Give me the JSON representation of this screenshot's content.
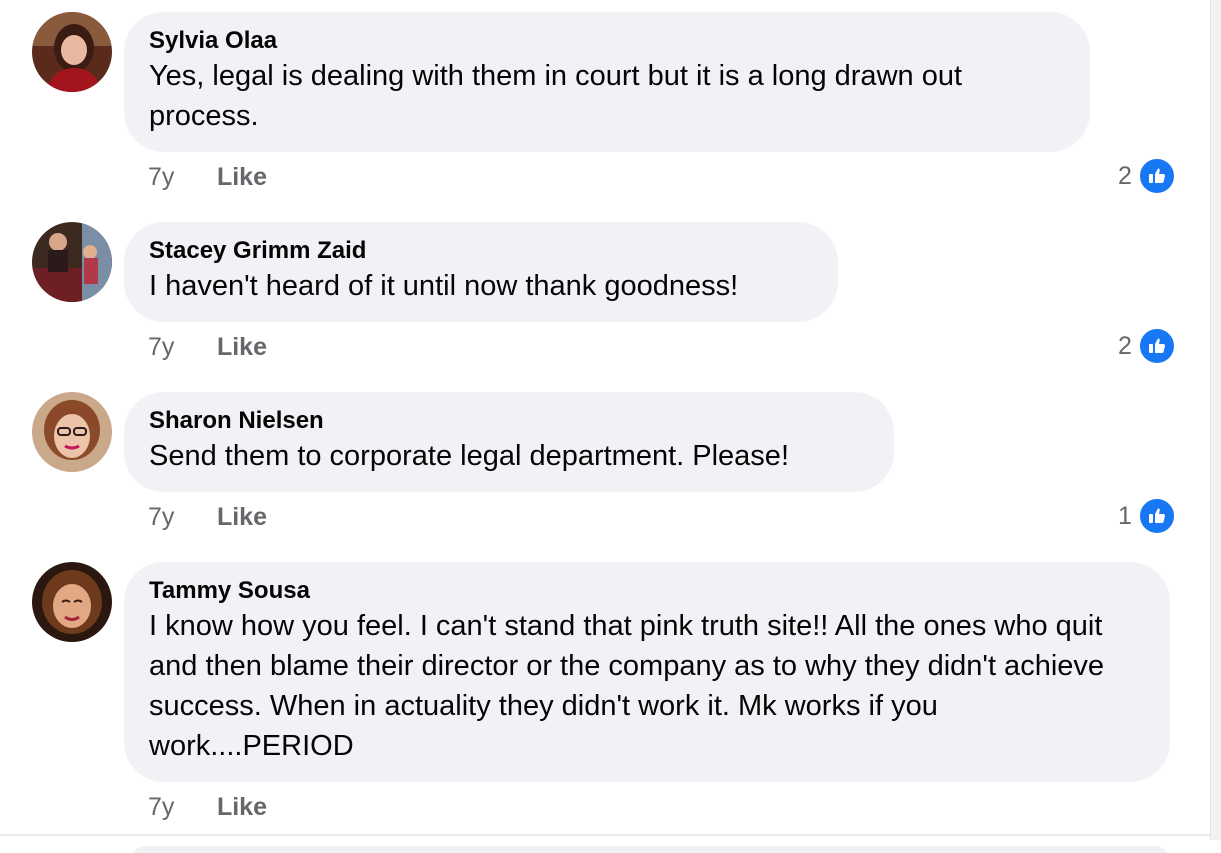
{
  "comments": [
    {
      "author": "Sylvia Olaa",
      "text": "Yes, legal is dealing with them in court but it is a long drawn out process.",
      "time": "7y",
      "like_label": "Like",
      "reaction_count": "2"
    },
    {
      "author": "Stacey Grimm Zaid",
      "text": "I haven't heard of it until now thank goodness!",
      "time": "7y",
      "like_label": "Like",
      "reaction_count": "2"
    },
    {
      "author": "Sharon Nielsen",
      "text": "Send them to corporate legal department. Please!",
      "time": "7y",
      "like_label": "Like",
      "reaction_count": "1"
    },
    {
      "author": "Tammy Sousa",
      "text": "I know how you feel. I can't stand that pink truth site!! All the ones who quit and then blame their director or the company as to why they didn't achieve success. When in actuality they didn't work it. Mk works if you work....PERIOD",
      "time": "7y",
      "like_label": "Like"
    }
  ],
  "colors": {
    "bubble": "#f0f2f5",
    "text": "#050505",
    "meta": "#65676b",
    "like_blue": "#1877f2"
  },
  "icons": {
    "reaction": "thumbs-up-icon",
    "avatar": "profile-photo"
  }
}
